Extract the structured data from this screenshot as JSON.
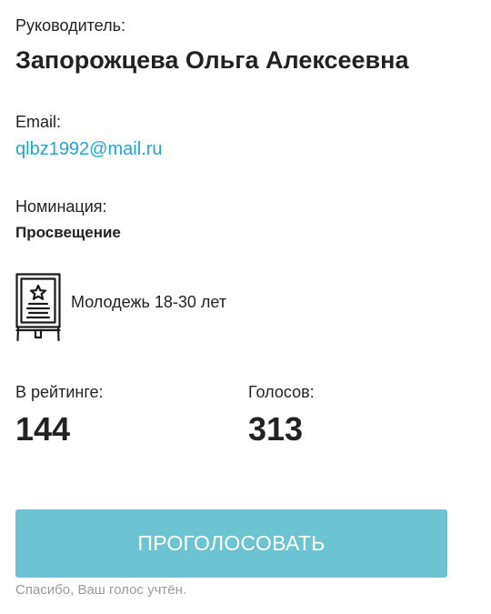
{
  "leader": {
    "label": "Руководитель:",
    "name": "Запорожцева Ольга Алексеевна"
  },
  "email": {
    "label": "Email:",
    "value": "qlbz1992@mail.ru",
    "color": "#1ea7d6"
  },
  "nomination": {
    "label": "Номинация:",
    "value": "Просвещение"
  },
  "category": {
    "icon": "certificate-easel-icon",
    "label": "Молодежь 18-30 лет"
  },
  "stats": {
    "rating_label": "В рейтинге:",
    "rating_value": "144",
    "votes_label": "Голосов:",
    "votes_value": "313"
  },
  "vote": {
    "button_label": "ПРОГОЛОСОВАТЬ",
    "button_color": "#6cc3d2",
    "thanks_message": "Спасибо, Ваш голос учтён."
  }
}
